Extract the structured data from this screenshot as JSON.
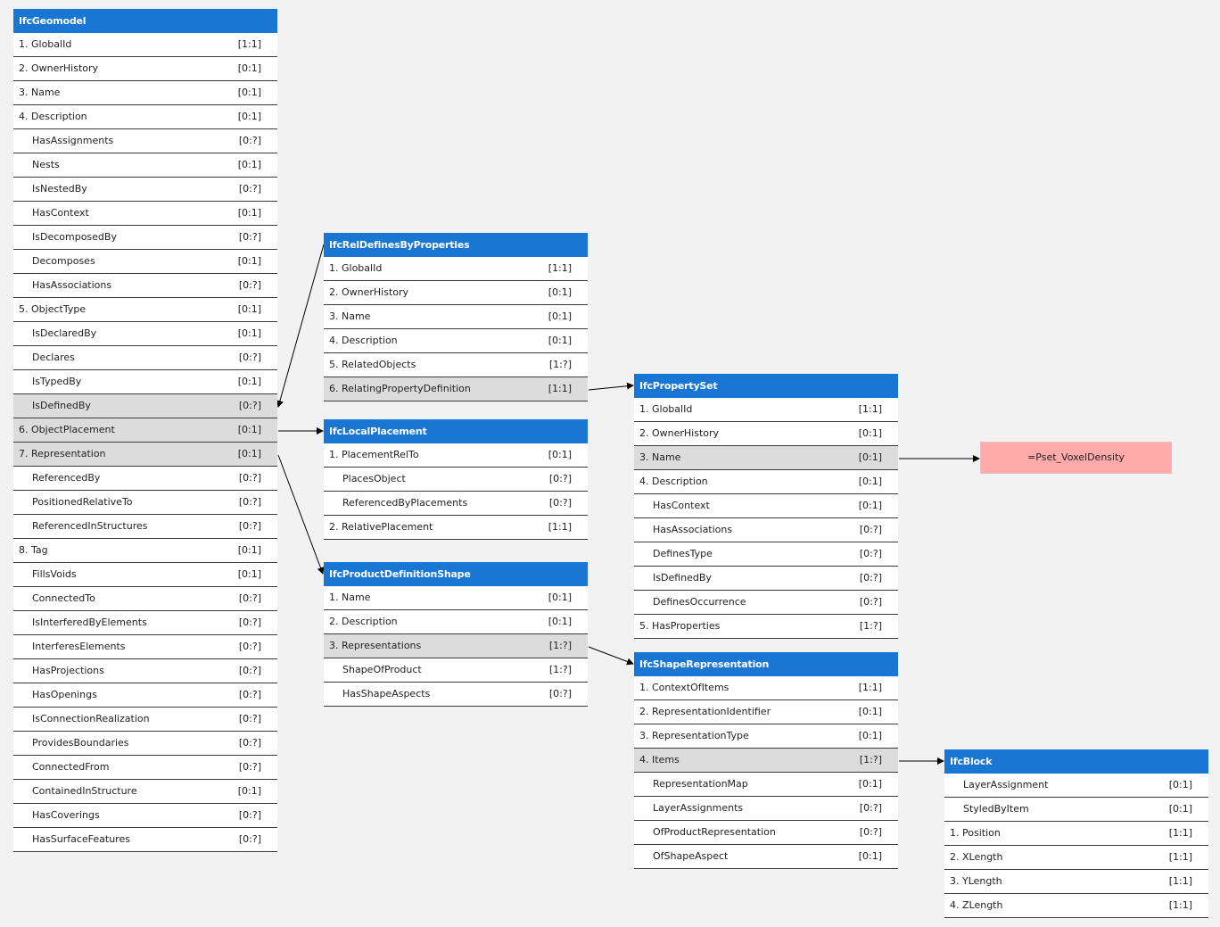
{
  "entities": [
    {
      "name": "IfcGeomodel",
      "rows": [
        {
          "label": "1. GlobalId",
          "card": "[1:1]"
        },
        {
          "label": "2. OwnerHistory",
          "card": "[0:1]"
        },
        {
          "label": "3. Name",
          "card": "[0:1]"
        },
        {
          "label": "4. Description",
          "card": "[0:1]"
        },
        {
          "label": "HasAssignments",
          "card": "[0:?]",
          "inv": true
        },
        {
          "label": "Nests",
          "card": "[0:1]",
          "inv": true
        },
        {
          "label": "IsNestedBy",
          "card": "[0:?]",
          "inv": true
        },
        {
          "label": "HasContext",
          "card": "[0:1]",
          "inv": true
        },
        {
          "label": "IsDecomposedBy",
          "card": "[0:?]",
          "inv": true
        },
        {
          "label": "Decomposes",
          "card": "[0:1]",
          "inv": true
        },
        {
          "label": "HasAssociations",
          "card": "[0:?]",
          "inv": true
        },
        {
          "label": "5. ObjectType",
          "card": "[0:1]"
        },
        {
          "label": "IsDeclaredBy",
          "card": "[0:1]",
          "inv": true
        },
        {
          "label": "Declares",
          "card": "[0:?]",
          "inv": true
        },
        {
          "label": "IsTypedBy",
          "card": "[0:1]",
          "inv": true
        },
        {
          "label": "IsDefinedBy",
          "card": "[0:?]",
          "inv": true,
          "hl": true
        },
        {
          "label": "6. ObjectPlacement",
          "card": "[0:1]",
          "hl": true
        },
        {
          "label": "7. Representation",
          "card": "[0:1]",
          "hl": true
        },
        {
          "label": "ReferencedBy",
          "card": "[0:?]",
          "inv": true
        },
        {
          "label": "PositionedRelativeTo",
          "card": "[0:?]",
          "inv": true
        },
        {
          "label": "ReferencedInStructures",
          "card": "[0:?]",
          "inv": true
        },
        {
          "label": "8. Tag",
          "card": "[0:1]"
        },
        {
          "label": "FillsVoids",
          "card": "[0:1]",
          "inv": true
        },
        {
          "label": "ConnectedTo",
          "card": "[0:?]",
          "inv": true
        },
        {
          "label": "IsInterferedByElements",
          "card": "[0:?]",
          "inv": true
        },
        {
          "label": "InterferesElements",
          "card": "[0:?]",
          "inv": true
        },
        {
          "label": "HasProjections",
          "card": "[0:?]",
          "inv": true
        },
        {
          "label": "HasOpenings",
          "card": "[0:?]",
          "inv": true
        },
        {
          "label": "IsConnectionRealization",
          "card": "[0:?]",
          "inv": true
        },
        {
          "label": "ProvidesBoundaries",
          "card": "[0:?]",
          "inv": true
        },
        {
          "label": "ConnectedFrom",
          "card": "[0:?]",
          "inv": true
        },
        {
          "label": "ContainedInStructure",
          "card": "[0:1]",
          "inv": true
        },
        {
          "label": "HasCoverings",
          "card": "[0:?]",
          "inv": true
        },
        {
          "label": "HasSurfaceFeatures",
          "card": "[0:?]",
          "inv": true
        }
      ]
    },
    {
      "name": "IfcRelDefinesByProperties",
      "rows": [
        {
          "label": "1. GlobalId",
          "card": "[1:1]"
        },
        {
          "label": "2. OwnerHistory",
          "card": "[0:1]"
        },
        {
          "label": "3. Name",
          "card": "[0:1]"
        },
        {
          "label": "4. Description",
          "card": "[0:1]"
        },
        {
          "label": "5. RelatedObjects",
          "card": "[1:?]"
        },
        {
          "label": "6. RelatingPropertyDefinition",
          "card": "[1:1]",
          "hl": true
        }
      ]
    },
    {
      "name": "IfcLocalPlacement",
      "rows": [
        {
          "label": "1. PlacementRelTo",
          "card": "[0:1]"
        },
        {
          "label": "PlacesObject",
          "card": "[0:?]",
          "inv": true
        },
        {
          "label": "ReferencedByPlacements",
          "card": "[0:?]",
          "inv": true
        },
        {
          "label": "2. RelativePlacement",
          "card": "[1:1]"
        }
      ]
    },
    {
      "name": "IfcProductDefinitionShape",
      "rows": [
        {
          "label": "1. Name",
          "card": "[0:1]"
        },
        {
          "label": "2. Description",
          "card": "[0:1]"
        },
        {
          "label": "3. Representations",
          "card": "[1:?]",
          "hl": true
        },
        {
          "label": "ShapeOfProduct",
          "card": "[1:?]",
          "inv": true
        },
        {
          "label": "HasShapeAspects",
          "card": "[0:?]",
          "inv": true
        }
      ]
    },
    {
      "name": "IfcPropertySet",
      "rows": [
        {
          "label": "1. GlobalId",
          "card": "[1:1]"
        },
        {
          "label": "2. OwnerHistory",
          "card": "[0:1]"
        },
        {
          "label": "3. Name",
          "card": "[0:1]",
          "hl": true
        },
        {
          "label": "4. Description",
          "card": "[0:1]"
        },
        {
          "label": "HasContext",
          "card": "[0:1]",
          "inv": true
        },
        {
          "label": "HasAssociations",
          "card": "[0:?]",
          "inv": true
        },
        {
          "label": "DefinesType",
          "card": "[0:?]",
          "inv": true
        },
        {
          "label": "IsDefinedBy",
          "card": "[0:?]",
          "inv": true
        },
        {
          "label": "DefinesOccurrence",
          "card": "[0:?]",
          "inv": true
        },
        {
          "label": "5. HasProperties",
          "card": "[1:?]"
        }
      ]
    },
    {
      "name": "IfcShapeRepresentation",
      "rows": [
        {
          "label": "1. ContextOfItems",
          "card": "[1:1]"
        },
        {
          "label": "2. RepresentationIdentifier",
          "card": "[0:1]"
        },
        {
          "label": "3. RepresentationType",
          "card": "[0:1]"
        },
        {
          "label": "4. Items",
          "card": "[1:?]",
          "hl": true
        },
        {
          "label": "RepresentationMap",
          "card": "[0:1]",
          "inv": true
        },
        {
          "label": "LayerAssignments",
          "card": "[0:?]",
          "inv": true
        },
        {
          "label": "OfProductRepresentation",
          "card": "[0:?]",
          "inv": true
        },
        {
          "label": "OfShapeAspect",
          "card": "[0:1]",
          "inv": true
        }
      ]
    },
    {
      "name": "IfcBlock",
      "rows": [
        {
          "label": "LayerAssignment",
          "card": "[0:1]",
          "inv": true
        },
        {
          "label": "StyledByItem",
          "card": "[0:1]",
          "inv": true
        },
        {
          "label": "1. Position",
          "card": "[1:1]"
        },
        {
          "label": "2. XLength",
          "card": "[1:1]"
        },
        {
          "label": "3. YLength",
          "card": "[1:1]"
        },
        {
          "label": "4. ZLength",
          "card": "[1:1]"
        }
      ]
    }
  ],
  "value_box": {
    "text": "=Pset_VoxelDensity",
    "color": "#ffabab"
  },
  "colors": {
    "header": "#1976d2",
    "highlight": "#dcdcdc",
    "background": "#f2f2f2"
  }
}
